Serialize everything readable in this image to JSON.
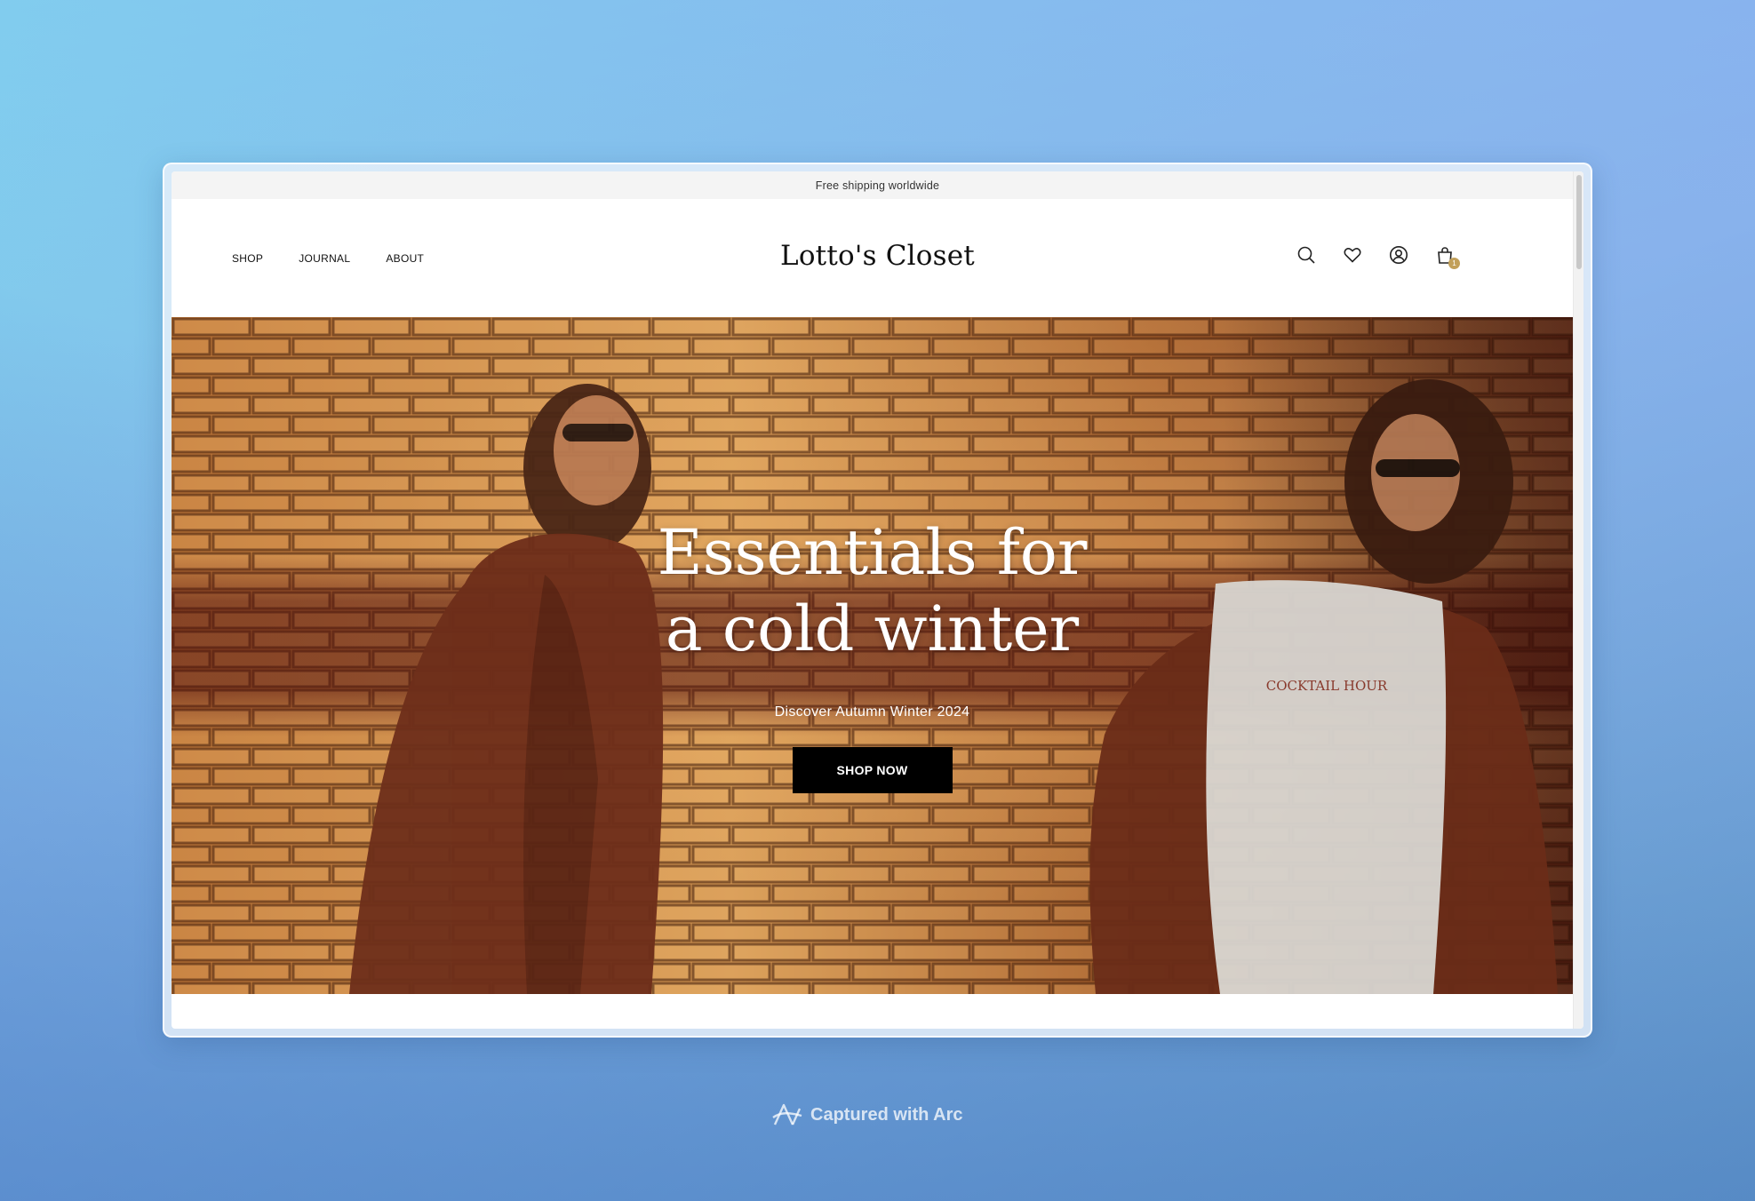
{
  "announcement": {
    "text": "Free shipping worldwide"
  },
  "nav": {
    "items": [
      {
        "label": "SHOP"
      },
      {
        "label": "JOURNAL"
      },
      {
        "label": "ABOUT"
      }
    ]
  },
  "brand": {
    "name": "Lotto's Closet"
  },
  "header_icons": {
    "search": "search-icon",
    "wishlist": "heart-icon",
    "account": "account-icon",
    "cart": "cart-icon",
    "cart_count": "1"
  },
  "hero": {
    "title_line1": "Essentials for",
    "title_line2": "a cold winter",
    "subtitle": "Discover Autumn Winter 2024",
    "cta_label": "SHOP NOW"
  },
  "watermark": {
    "text": "Captured with Arc"
  },
  "colors": {
    "accent_badge": "#c2a05a",
    "cta_background": "#000000",
    "announcement_bg": "#f4f4f4"
  }
}
